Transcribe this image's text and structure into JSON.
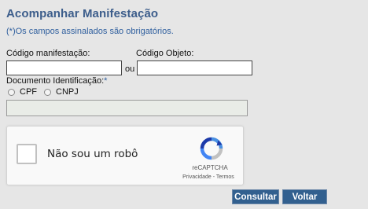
{
  "form": {
    "title": "Acompanhar Manifestação",
    "required_note": "(*)Os campos assinalados são obrigatórios.",
    "codigo_manifestacao_label": "Código manifestação:",
    "codigo_manifestacao_value": "",
    "separator": "ou",
    "codigo_objeto_label": "Código Objeto:",
    "codigo_objeto_value": "",
    "documento_label": "Documento Identificação:",
    "required_marker": "*",
    "documento_options": [
      "CPF",
      "CNPJ"
    ],
    "documento_value": ""
  },
  "captcha": {
    "checkbox_text": "Não sou um robô",
    "brand": "reCAPTCHA",
    "privacy_link": "Privacidade",
    "link_separator": " - ",
    "terms_link": "Termos"
  },
  "buttons": {
    "consultar": "Consultar",
    "voltar": "Voltar"
  },
  "colors": {
    "background": "#e6e6e6",
    "title": "#3c5d8b",
    "button": "#32608f"
  }
}
